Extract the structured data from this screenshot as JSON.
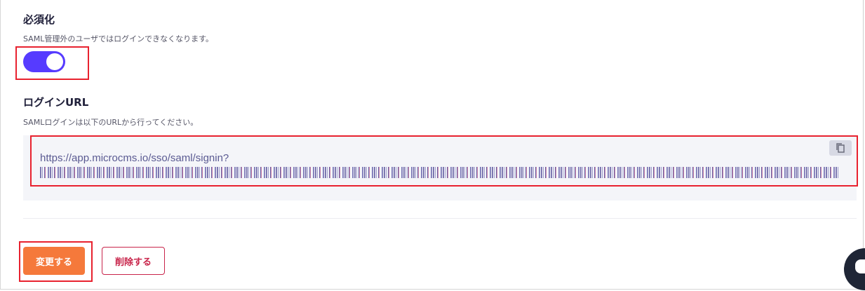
{
  "enforce": {
    "title": "必須化",
    "description": "SAML管理外のユーザではログインできなくなります。",
    "toggle_on": true
  },
  "login_url": {
    "title": "ログインURL",
    "description": "SAMLログインは以下のURLから行ってください。",
    "url": "https://app.microcms.io/sso/saml/signin?",
    "copy_icon": "copy-icon"
  },
  "actions": {
    "submit_label": "変更する",
    "delete_label": "削除する"
  },
  "colors": {
    "toggle": "#563bff",
    "primary": "#f5793b",
    "danger": "#c8244a",
    "highlight": "#e8222f"
  }
}
